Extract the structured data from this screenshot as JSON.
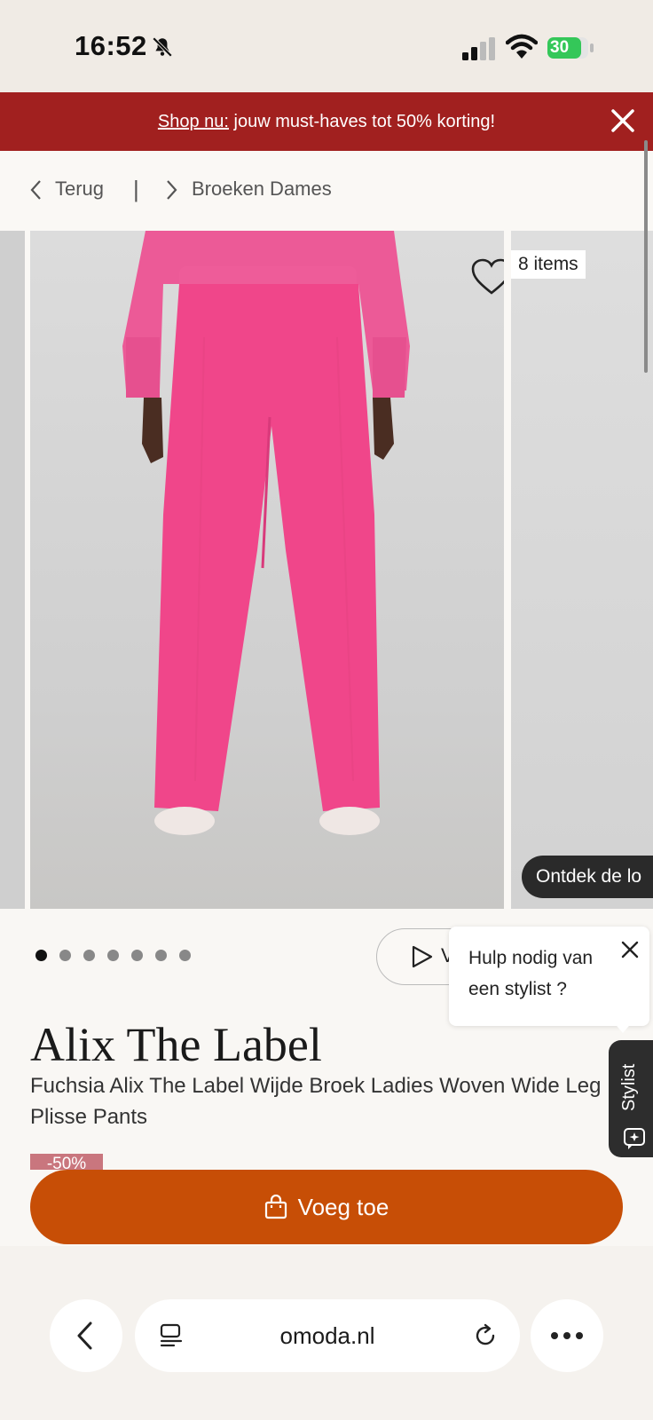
{
  "status_bar": {
    "time": "16:52",
    "battery": "30"
  },
  "promo": {
    "link_text": "Shop nu:",
    "text": " jouw must-haves tot 50% korting!"
  },
  "breadcrumb": {
    "back_label": "Terug",
    "separator": "|",
    "category": "Broeken Dames"
  },
  "gallery": {
    "items_count": "8 items",
    "discover_label": "Ontdek de lo",
    "dot_count": 7,
    "active_dot": 0
  },
  "video_button": {
    "label": "V"
  },
  "stylist_popup": {
    "text": "Hulp nodig van een stylist ?",
    "tab_label": "Stylist"
  },
  "product": {
    "brand": "Alix The Label",
    "name": "Fuchsia Alix The Label Wijde Broek Ladies Woven Wide Leg Plisse Pants",
    "discount_badge": "-50%"
  },
  "cart_button": {
    "label": "Voeg toe"
  },
  "browser": {
    "url": "omoda.nl"
  },
  "colors": {
    "promo_bg": "#a1201f",
    "cart_bg": "#c74e06",
    "pants": "#f0468a"
  }
}
